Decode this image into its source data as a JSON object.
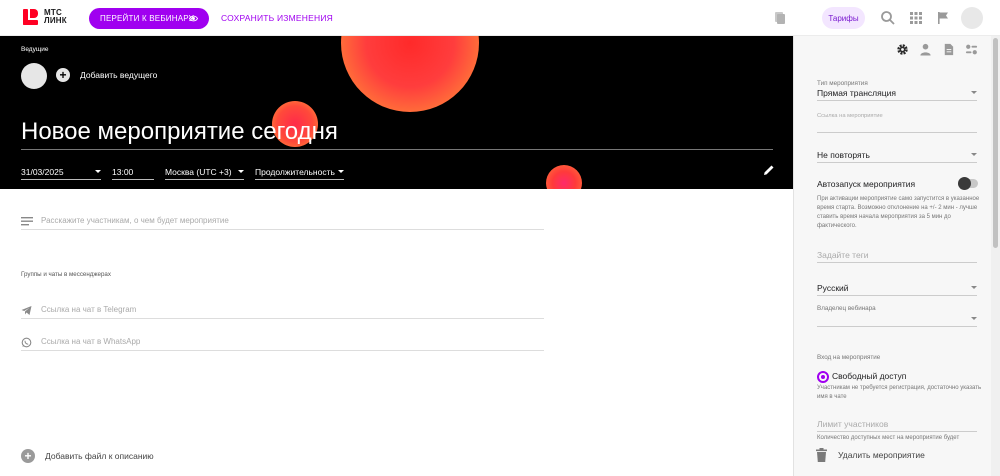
{
  "header": {
    "logo_text_1": "МТС",
    "logo_text_2": "ЛИНК",
    "go_to_webinar": "ПЕРЕЙТИ К ВЕБИНАРУ",
    "save_changes": "СОХРАНИТЬ ИЗМЕНЕНИЯ",
    "tariffs": "Тарифы"
  },
  "hero": {
    "hosts_label": "Ведущие",
    "add_host": "Добавить ведущего",
    "title": "Новое мероприятие сегодня",
    "date": "31/03/2025",
    "time": "13:00",
    "timezone": "Москва (UTC +3)",
    "duration": "Продолжительность"
  },
  "main": {
    "description_placeholder": "Расскажите участникам, о чем будет мероприятие",
    "groups_label": "Группы и чаты в мессенджерах",
    "telegram_placeholder": "Ссылка на чат в Telegram",
    "whatsapp_placeholder": "Ссылка на чат в WhatsApp",
    "add_file": "Добавить файл к описанию"
  },
  "sidebar": {
    "event_type_label": "Тип мероприятия",
    "event_type_value": "Прямая трансляция",
    "event_link_label": "Ссылка на мероприятие",
    "repeat_value": "Не повторять",
    "autostart_label": "Автозапуск мероприятия",
    "autostart_hint": "При активации мероприятие само запустится в указанное время старта. Возможно отклонение на +/- 2 мин - лучше ставить время начала мероприятия за 5 мин до фактического.",
    "tags_placeholder": "Задайте теги",
    "language_value": "Русский",
    "owner_label": "Владелец вебинара",
    "access_label": "Вход на мероприятие",
    "free_access_label": "Свободный доступ",
    "free_access_hint": "Участникам не требуется регистрация, достаточно указать имя в чате",
    "limit_placeholder": "Лимит участников",
    "limit_hint": "Количество доступных мест на мероприятие будет",
    "delete_event": "Удалить мероприятие"
  },
  "colors": {
    "accent": "#a000f0",
    "brand_red": "#ff0023",
    "hero_bg": "#000000",
    "tariffs_bg": "#f3e6ff"
  }
}
